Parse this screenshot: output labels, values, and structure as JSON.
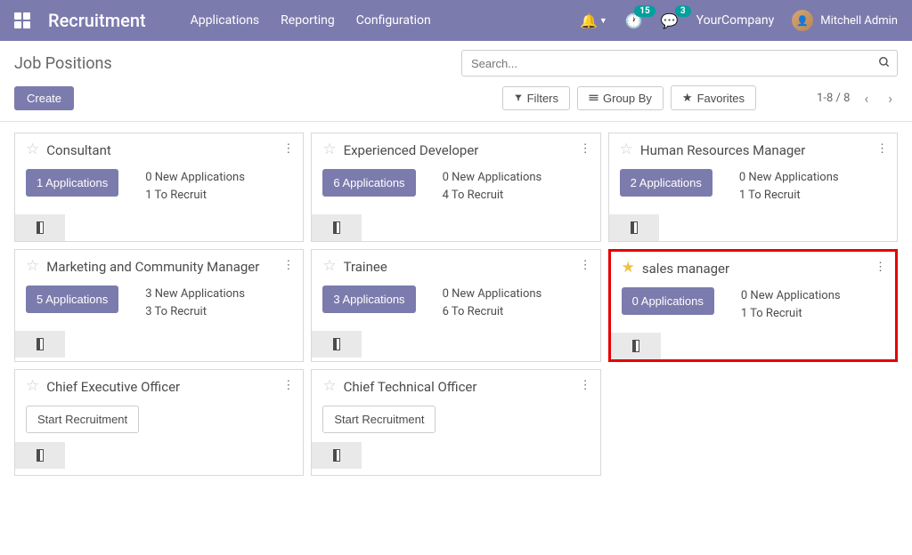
{
  "navbar": {
    "brand": "Recruitment",
    "menu": [
      "Applications",
      "Reporting",
      "Configuration"
    ],
    "activities_badge": "15",
    "messages_badge": "3",
    "company": "YourCompany",
    "user": "Mitchell Admin"
  },
  "cp": {
    "breadcrumb": "Job Positions",
    "search_placeholder": "Search...",
    "create": "Create",
    "filters": "Filters",
    "groupby": "Group By",
    "favorites": "Favorites",
    "pager": "1-8 / 8"
  },
  "cards": [
    {
      "title": "Consultant",
      "starred": false,
      "apps_btn": "1 Applications",
      "line1": "0 New Applications",
      "line2": "1 To Recruit",
      "highlight": false,
      "start": false
    },
    {
      "title": "Experienced Developer",
      "starred": false,
      "apps_btn": "6 Applications",
      "line1": "0 New Applications",
      "line2": "4 To Recruit",
      "highlight": false,
      "start": false
    },
    {
      "title": "Human Resources Manager",
      "starred": false,
      "apps_btn": "2 Applications",
      "line1": "0 New Applications",
      "line2": "1 To Recruit",
      "highlight": false,
      "start": false
    },
    {
      "title": "Marketing and Community Manager",
      "starred": false,
      "apps_btn": "5 Applications",
      "line1": "3 New Applications",
      "line2": "3 To Recruit",
      "highlight": false,
      "start": false
    },
    {
      "title": "Trainee",
      "starred": false,
      "apps_btn": "3 Applications",
      "line1": "0 New Applications",
      "line2": "6 To Recruit",
      "highlight": false,
      "start": false
    },
    {
      "title": "sales manager",
      "starred": true,
      "apps_btn": "0 Applications",
      "line1": "0 New Applications",
      "line2": "1 To Recruit",
      "highlight": true,
      "start": false
    },
    {
      "title": "Chief Executive Officer",
      "starred": false,
      "start": true,
      "start_label": "Start Recruitment",
      "highlight": false
    },
    {
      "title": "Chief Technical Officer",
      "starred": false,
      "start": true,
      "start_label": "Start Recruitment",
      "highlight": false
    }
  ]
}
